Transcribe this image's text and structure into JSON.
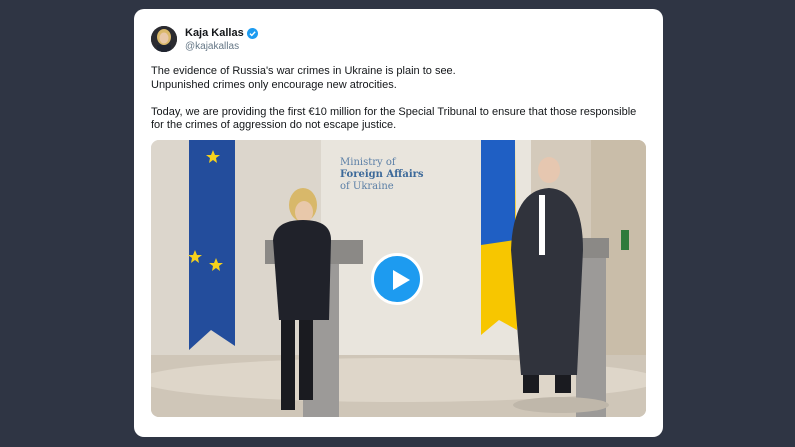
{
  "tweet": {
    "author_name": "Kaja Kallas",
    "author_handle": "@kajakallas",
    "verified": true,
    "lines": [
      "The evidence of Russia's war crimes in Ukraine is plain to see.",
      "Unpunished crimes only encourage new atrocities.",
      "",
      "Today, we are providing the first €10 million for the Special Tribunal to ensure that those responsible",
      "for the crimes of aggression do not escape justice."
    ]
  },
  "media": {
    "type": "video",
    "play_button_icon": "play-icon",
    "backdrop_text": {
      "line1": "Ministry of",
      "line2": "Foreign Affairs",
      "line3": "of Ukraine"
    }
  },
  "colors": {
    "page_bg": "#2f3544",
    "card_bg": "#ffffff",
    "play_button": "#1d9bf0",
    "verified_badge": "#1d9bf0"
  }
}
